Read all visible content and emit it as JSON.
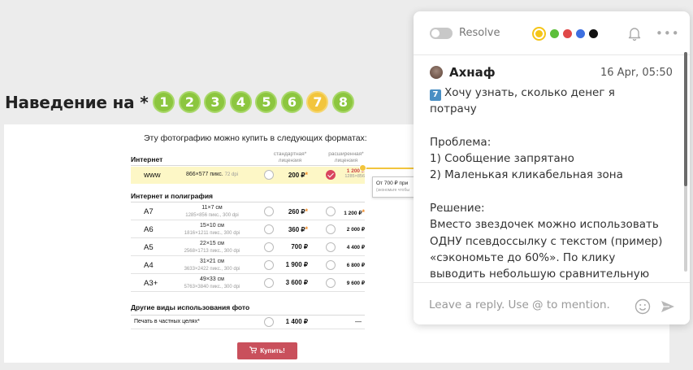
{
  "heading": {
    "title": "Наведение на *",
    "steps": [
      "1",
      "2",
      "3",
      "4",
      "5",
      "6",
      "7",
      "8"
    ],
    "current_step": "7"
  },
  "screenshot": {
    "intro": "Эту фотографию можно купить в следующих форматах:",
    "section_internet": "Интернет",
    "col_standard": "стандартная* лицензия",
    "col_extended": "расширенная* лицензия",
    "www_row": {
      "format": "www",
      "dims": "866×577 пикс.",
      "dpi": "72 dpi",
      "price_standard": "200 ₽",
      "price_extended": "1 200 ₽",
      "price_extended_sub": "1285×856"
    },
    "section_print": "Интернет и полиграфия",
    "rows": [
      {
        "format": "A7",
        "size": "11×7 см",
        "dims": "1285×856 пикс., 300 dpi",
        "price_standard": "260 ₽",
        "price_extended": "1 200 ₽",
        "star": true
      },
      {
        "format": "A6",
        "size": "15×10 см",
        "dims": "1816×1211 пикс., 300 dpi",
        "price_standard": "360 ₽",
        "price_extended": "2 000 ₽",
        "star": true
      },
      {
        "format": "A5",
        "size": "22×15 см",
        "dims": "2568×1713 пикс., 300 dpi",
        "price_standard": "700 ₽",
        "price_extended": "4 400 ₽",
        "star": false
      },
      {
        "format": "A4",
        "size": "31×21 см",
        "dims": "3633×2422 пикс., 300 dpi",
        "price_standard": "1 900 ₽",
        "price_extended": "6 800 ₽",
        "star": false
      },
      {
        "format": "A3+",
        "size": "49×33 см",
        "dims": "5763×3840 пикс., 300 dpi",
        "price_standard": "3 600 ₽",
        "price_extended": "9 600 ₽",
        "star": false
      }
    ],
    "section_other": "Другие виды использования фото",
    "other_row": {
      "label": "Печать в частных целях*",
      "price": "1 400 ₽",
      "dash": "—"
    },
    "tooltip": {
      "text": "От 700 ₽ при",
      "sub": "(экономьте чтобы"
    },
    "buy_label": "Купить!"
  },
  "panel": {
    "resolve_label": "Resolve",
    "colors": [
      "#f5c518",
      "#5cbf3a",
      "#e04848",
      "#3d6fe0",
      "#111111"
    ],
    "selected_color": "#f5c518",
    "author": "Ахнаф",
    "time": "16 Apr, 05:50",
    "badge": "7",
    "lines": [
      "Хочу узнать, сколько денег я",
      "потрачу",
      "",
      "Проблема:",
      "1) Сообщение запрятано",
      "2) Маленькая кликабельная зона",
      "",
      "Решение:",
      "Вместо звездочек можно использовать",
      "ОДНУ псевдоссылку с текстом (пример)",
      "«сэкономьте до 60%». По клику",
      "выводить небольшую сравнительную"
    ],
    "reply_placeholder": "Leave a reply. Use @ to mention."
  }
}
